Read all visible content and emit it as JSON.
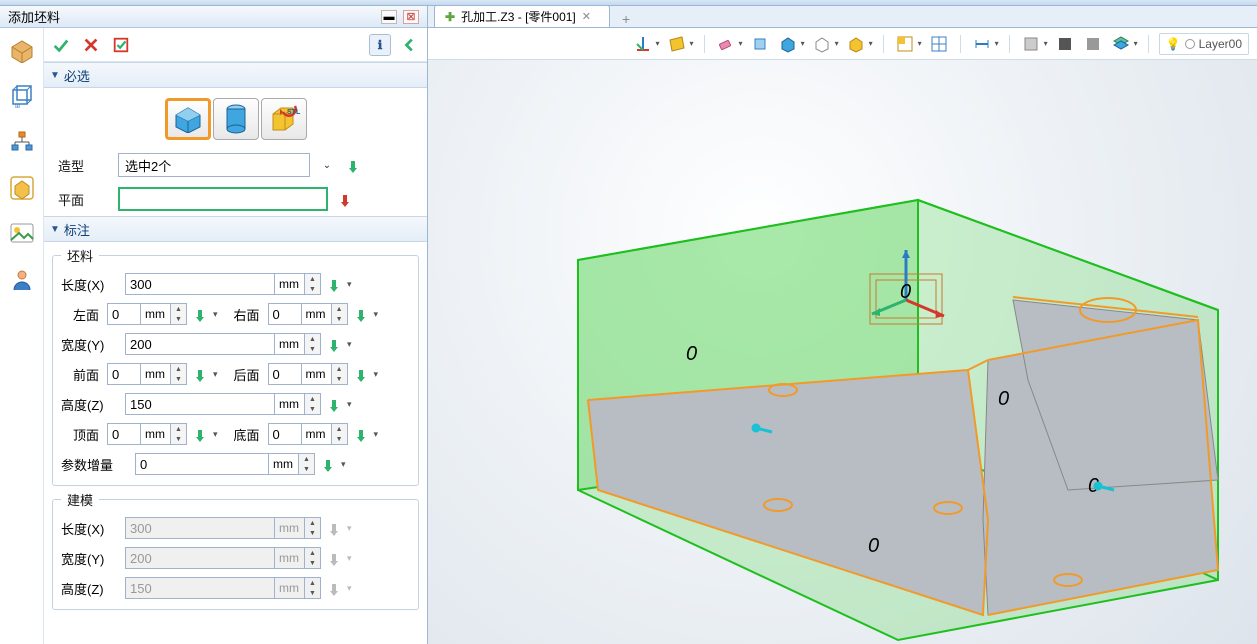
{
  "panel": {
    "title": "添加坯料",
    "sections": {
      "required": "必选",
      "annotate": "标注"
    },
    "shape_label": "造型",
    "shape_value": "选中2个",
    "plane_label": "平面",
    "plane_value": ""
  },
  "stock": {
    "legend": "坯料",
    "length_label": "长度(X)",
    "length_value": "300",
    "left_label": "左面",
    "left_value": "0",
    "right_label": "右面",
    "right_value": "0",
    "width_label": "宽度(Y)",
    "width_value": "200",
    "front_label": "前面",
    "front_value": "0",
    "back_label": "后面",
    "back_value": "0",
    "height_label": "高度(Z)",
    "height_value": "150",
    "top_label": "顶面",
    "top_value": "0",
    "bottom_label": "底面",
    "bottom_value": "0",
    "increment_label": "参数增量",
    "increment_value": "0",
    "unit": "mm"
  },
  "model": {
    "legend": "建模",
    "length_label": "长度(X)",
    "length_value": "300",
    "width_label": "宽度(Y)",
    "width_value": "200",
    "height_label": "高度(Z)",
    "height_value": "150",
    "unit": "mm"
  },
  "tab": {
    "title": "孔加工.Z3 - [零件001]"
  },
  "layer": {
    "label": "Layer00"
  },
  "viewport": {
    "dim_labels": [
      "0",
      "0",
      "0",
      "0",
      "0"
    ]
  }
}
